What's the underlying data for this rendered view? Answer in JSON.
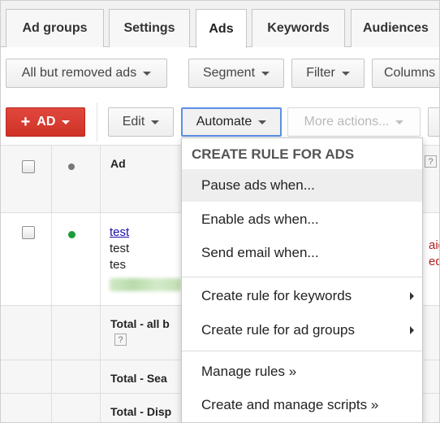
{
  "tabs": [
    {
      "label": "Ad groups",
      "active": false
    },
    {
      "label": "Settings",
      "active": false
    },
    {
      "label": "Ads",
      "active": true
    },
    {
      "label": "Keywords",
      "active": false
    },
    {
      "label": "Audiences",
      "active": false
    }
  ],
  "filter_bar": {
    "view_filter": "All but removed ads",
    "segment": "Segment",
    "filter": "Filter",
    "columns": "Columns"
  },
  "action_bar": {
    "add_ad": "AD",
    "edit": "Edit",
    "automate": "Automate",
    "more_actions": "More actions..."
  },
  "table": {
    "header": {
      "ad": "Ad",
      "help": "?"
    },
    "ad_row": {
      "headline": "test",
      "line1": "test",
      "line2": "tes",
      "right_partial_1": "aig",
      "right_partial_2": "ed"
    },
    "totals": [
      {
        "label": "Total - all b",
        "help": "?"
      },
      {
        "label": "Total - Sea"
      },
      {
        "label": "Total - Disp"
      }
    ]
  },
  "automate_menu": {
    "heading": "CREATE RULE FOR ADS",
    "items": [
      {
        "label": "Pause ads when...",
        "hover": true
      },
      {
        "label": "Enable ads when..."
      },
      {
        "label": "Send email when..."
      }
    ],
    "submenus": [
      {
        "label": "Create rule for keywords"
      },
      {
        "label": "Create rule for ad groups"
      }
    ],
    "links": [
      {
        "label": "Manage rules »"
      },
      {
        "label": "Create and manage scripts »"
      }
    ]
  },
  "colors": {
    "add_button": "#d63a2f",
    "automate_border": "#5b8fe6",
    "status_enabled": "#1e9b3a",
    "link": "#1a0dab",
    "warning_text": "#b21e1e"
  }
}
